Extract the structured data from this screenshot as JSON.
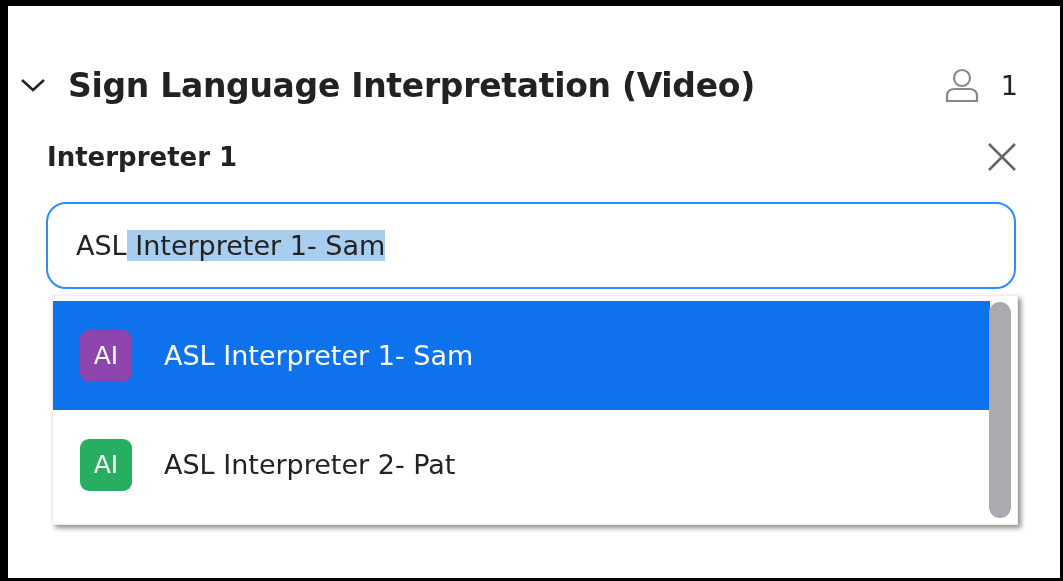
{
  "section": {
    "title": "Sign Language Interpretation (Video)",
    "expanded": true,
    "participant_count": "1"
  },
  "interpreter": {
    "label": "Interpreter 1",
    "field": {
      "typed": "ASL",
      "completion": " Interpreter 1- Sam"
    }
  },
  "suggestions": [
    {
      "initials": "AI",
      "name": "ASL Interpreter 1- Sam",
      "color": "#8e44ad",
      "selected": true
    },
    {
      "initials": "AI",
      "name": "ASL Interpreter 2- Pat",
      "color": "#27ae60",
      "selected": false
    }
  ]
}
